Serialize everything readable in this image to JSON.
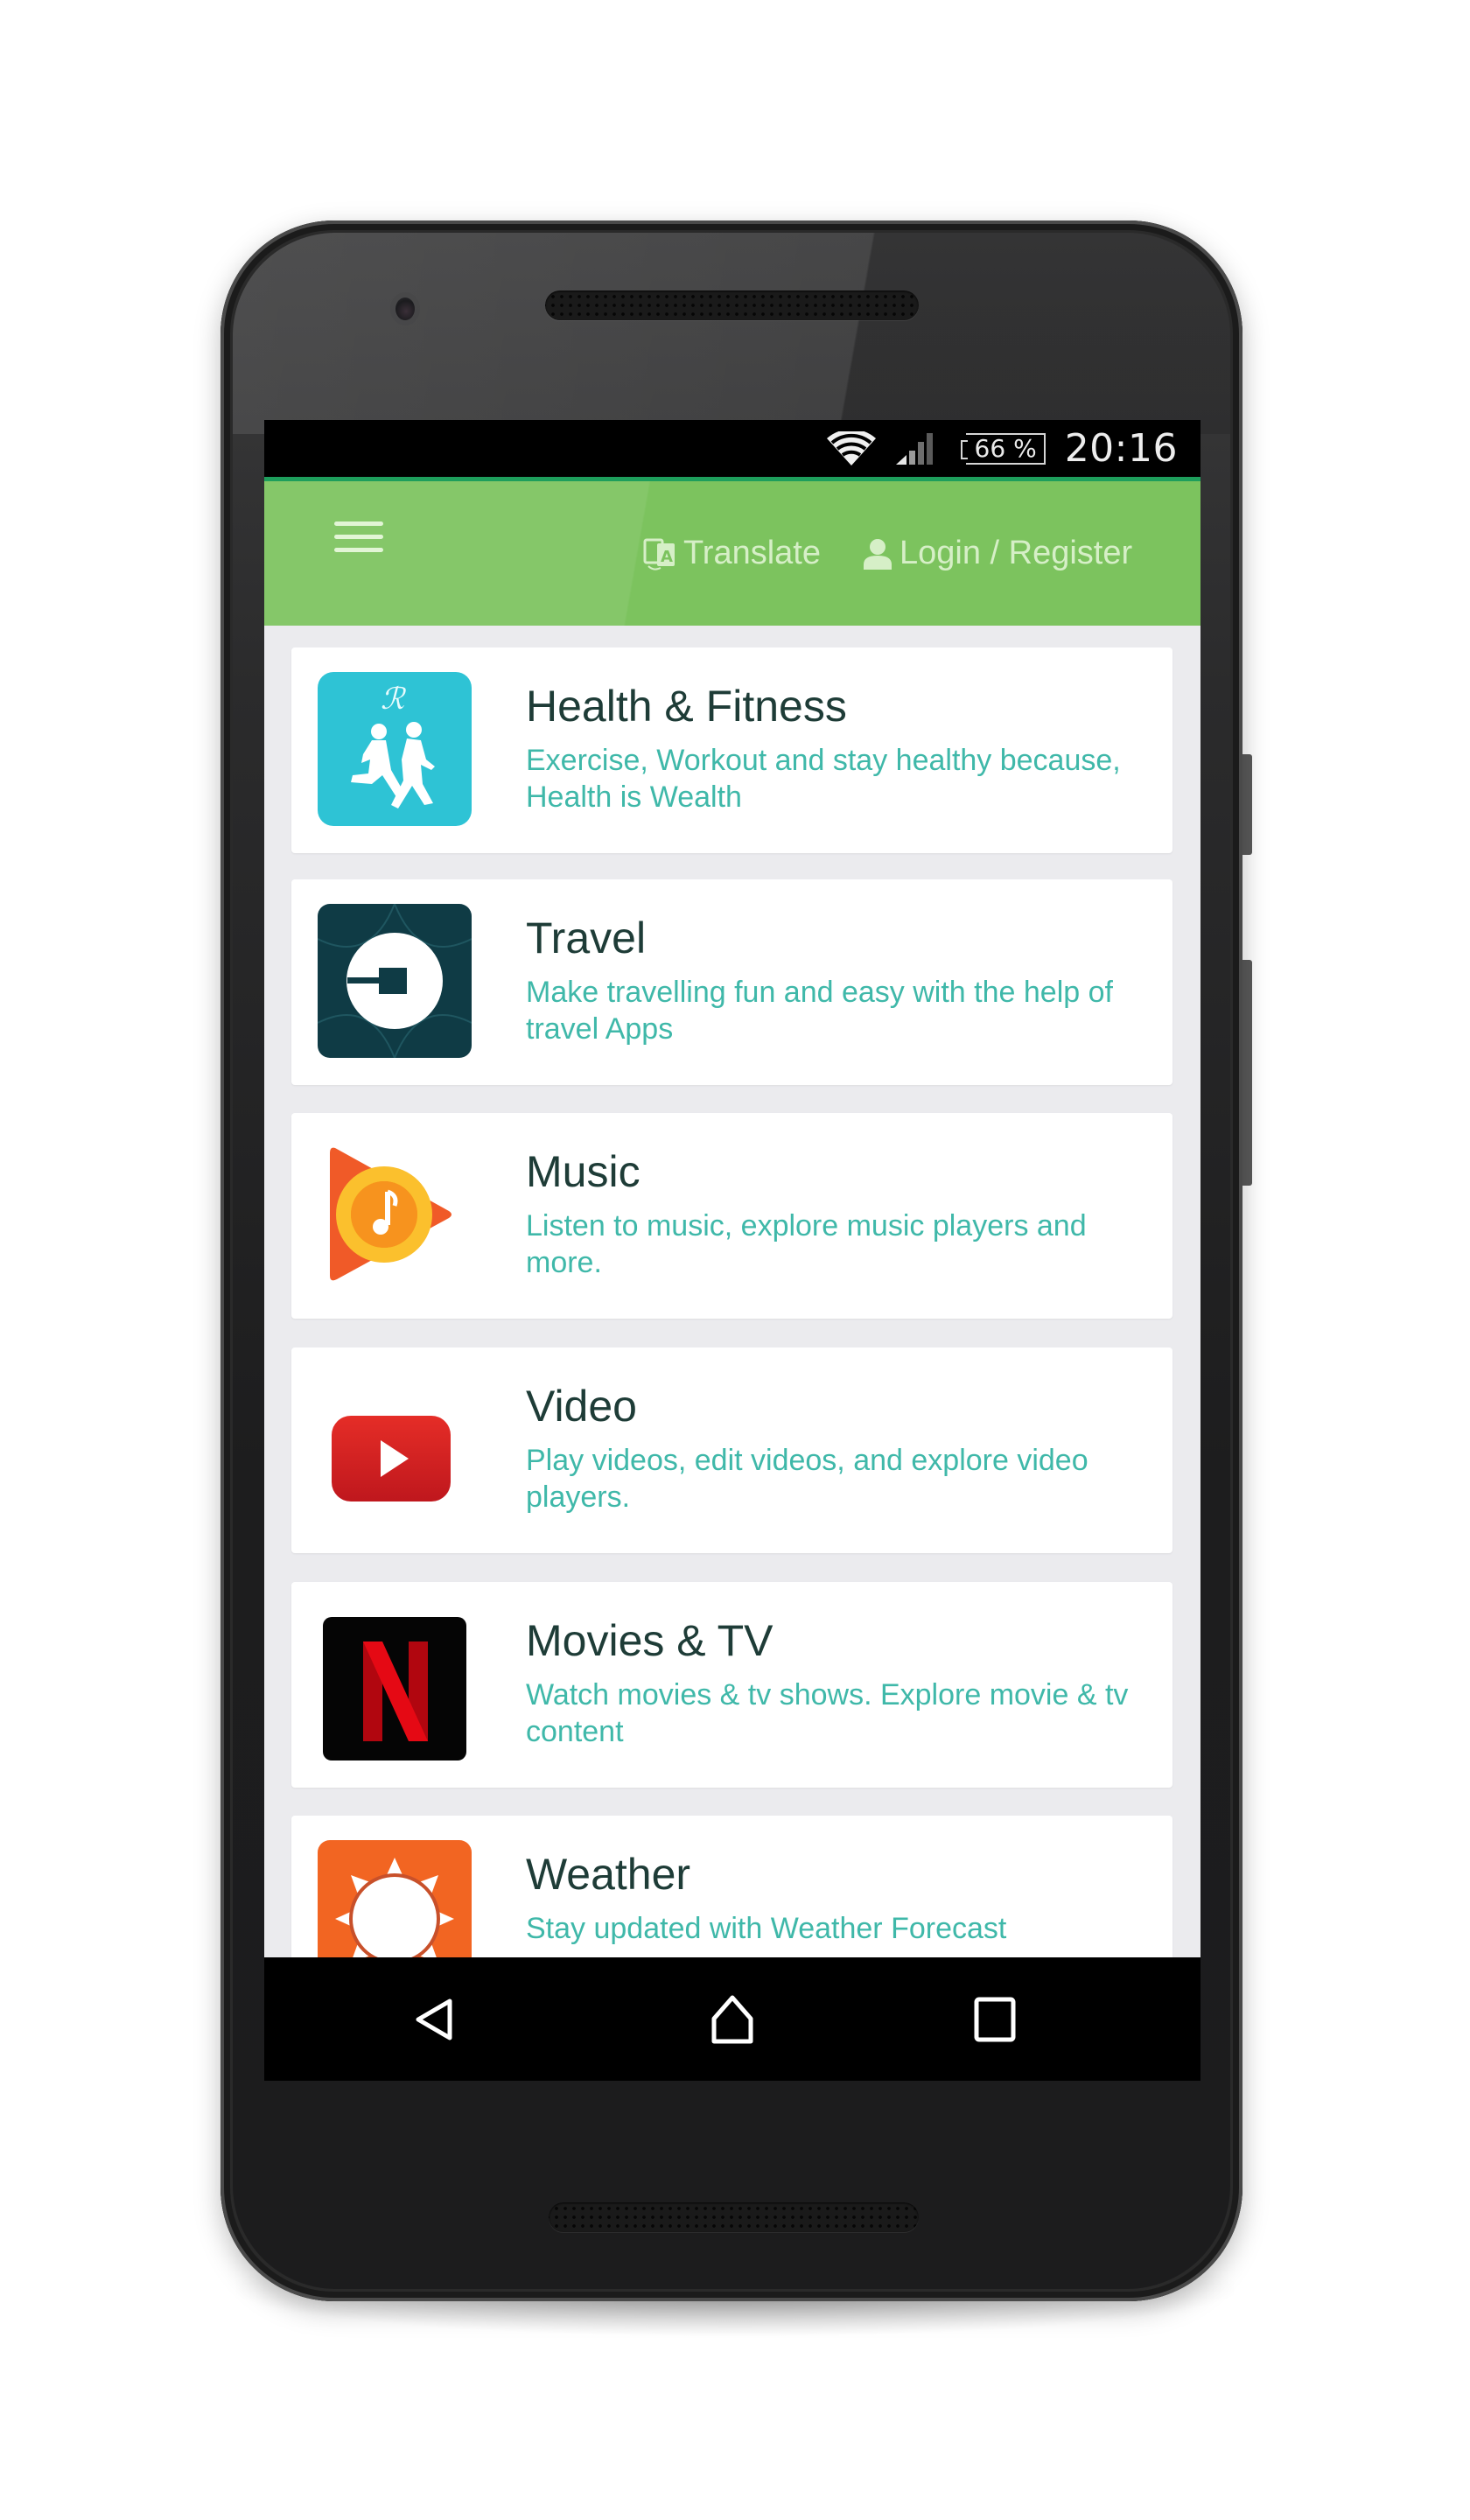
{
  "status_bar": {
    "wifi_icon": "wifi-icon",
    "signal_icon": "cell-signal-icon",
    "battery_percent": "66 %",
    "time": "20:16"
  },
  "toolbar": {
    "menu_icon": "hamburger-menu-icon",
    "translate_label": "Translate",
    "translate_icon": "translate-icon",
    "login_label": "Login / Register",
    "login_icon": "person-icon",
    "accent_color": "#7cc35e"
  },
  "categories": [
    {
      "title": "Health & Fitness",
      "description": "Exercise, Workout and stay healthy because, Health is Wealth",
      "icon": "runners-icon"
    },
    {
      "title": "Travel",
      "description": "Make travelling fun and easy with the help of travel Apps",
      "icon": "uber-icon"
    },
    {
      "title": "Music",
      "description": "Listen to music, explore music players and more.",
      "icon": "play-music-icon"
    },
    {
      "title": "Video",
      "description": "Play videos, edit videos, and explore video players.",
      "icon": "youtube-icon"
    },
    {
      "title": "Movies & TV",
      "description": "Watch movies & tv shows. Explore movie & tv content",
      "icon": "netflix-icon"
    },
    {
      "title": "Weather",
      "description": "Stay updated with Weather Forecast",
      "icon": "sun-weather-icon"
    }
  ],
  "nav_bar": {
    "back_icon": "back-triangle-icon",
    "home_icon": "home-icon",
    "recents_icon": "recents-square-icon"
  }
}
